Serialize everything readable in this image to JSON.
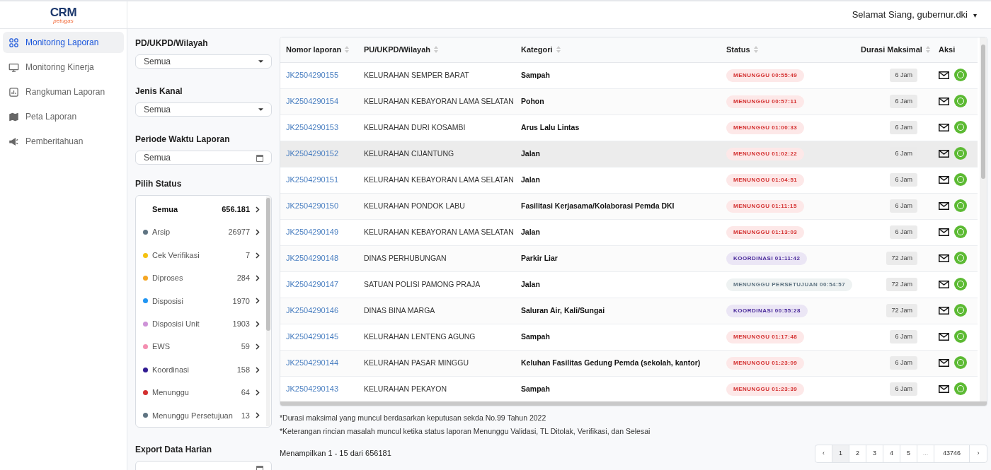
{
  "logo": {
    "brand": "CRM",
    "sub": "petugas"
  },
  "header": {
    "greeting": "Selamat Siang, gubernur.dki",
    "caret": "▾"
  },
  "sidebar": {
    "items": [
      {
        "label": "Monitoring Laporan",
        "selected": true
      },
      {
        "label": "Monitoring Kinerja",
        "selected": false
      },
      {
        "label": "Rangkuman Laporan",
        "selected": false
      },
      {
        "label": "Peta Laporan",
        "selected": false
      },
      {
        "label": "Pemberitahuan",
        "selected": false
      }
    ]
  },
  "filters": [
    {
      "label": "PD/UKPD/Wilayah",
      "value": "Semua",
      "kind": "dropdown"
    },
    {
      "label": "Jenis Kanal",
      "value": "Semua",
      "kind": "dropdown"
    },
    {
      "label": "Periode Waktu Laporan",
      "value": "Semua",
      "kind": "date"
    }
  ],
  "status_filter": {
    "label": "Pilih Status",
    "items": [
      {
        "label": "Semua",
        "count": "656.181",
        "selected": true
      },
      {
        "label": "Arsip",
        "count": "26977",
        "color": "#5f7482",
        "selected": false
      },
      {
        "label": "Cek Verifikasi",
        "count": "7",
        "color": "#f5c211",
        "selected": false
      },
      {
        "label": "Diproses",
        "count": "284",
        "color": "#f5a623",
        "selected": false
      },
      {
        "label": "Disposisi",
        "count": "1970",
        "color": "#2196f3",
        "selected": false
      },
      {
        "label": "Disposisi Unit",
        "count": "1903",
        "color": "#ce93d8",
        "selected": false
      },
      {
        "label": "EWS",
        "count": "59",
        "color": "#f48fb1",
        "selected": false
      },
      {
        "label": "Koordinasi",
        "count": "158",
        "color": "#311b92",
        "selected": false
      },
      {
        "label": "Menunggu",
        "count": "64",
        "color": "#d32f2f",
        "selected": false
      },
      {
        "label": "Menunggu Persetujuan",
        "count": "13",
        "color": "#5f7482",
        "selected": false
      }
    ]
  },
  "export": {
    "label": "Export Data Harian"
  },
  "table": {
    "columns": [
      {
        "label": "Nomor laporan",
        "sortable": true
      },
      {
        "label": "PU/UKPD/Wilayah",
        "sortable": true
      },
      {
        "label": "Kategori",
        "sortable": true
      },
      {
        "label": "Status",
        "sortable": true
      },
      {
        "label": "Durasi Maksimal",
        "sortable": true
      },
      {
        "label": "Aksi",
        "sortable": false
      }
    ],
    "rows": [
      {
        "id": "JK2504290155",
        "unit": "KELURAHAN SEMPER BARAT",
        "category": "Sampah",
        "status": "MENUNGGU 00:55:49",
        "kind": "menunggu",
        "duration": "6 Jam",
        "selected": false
      },
      {
        "id": "JK2504290154",
        "unit": "KELURAHAN KEBAYORAN LAMA SELATAN",
        "category": "Pohon",
        "status": "MENUNGGU 00:57:11",
        "kind": "menunggu",
        "duration": "6 Jam",
        "selected": false
      },
      {
        "id": "JK2504290153",
        "unit": "KELURAHAN DURI KOSAMBI",
        "category": "Arus Lalu Lintas",
        "status": "MENUNGGU 01:00:33",
        "kind": "menunggu",
        "duration": "6 Jam",
        "selected": false
      },
      {
        "id": "JK2504290152",
        "unit": "KELURAHAN CIJANTUNG",
        "category": "Jalan",
        "status": "MENUNGGU 01:02:22",
        "kind": "menunggu",
        "duration": "6 Jam",
        "selected": true
      },
      {
        "id": "JK2504290151",
        "unit": "KELURAHAN KEBAYORAN LAMA SELATAN",
        "category": "Jalan",
        "status": "MENUNGGU 01:04:51",
        "kind": "menunggu",
        "duration": "6 Jam",
        "selected": false
      },
      {
        "id": "JK2504290150",
        "unit": "KELURAHAN PONDOK LABU",
        "category": "Fasilitasi Kerjasama/Kolaborasi Pemda DKI",
        "status": "MENUNGGU 01:11:15",
        "kind": "menunggu",
        "duration": "6 Jam",
        "selected": false
      },
      {
        "id": "JK2504290149",
        "unit": "KELURAHAN KEBAYORAN LAMA SELATAN",
        "category": "Jalan",
        "status": "MENUNGGU 01:13:03",
        "kind": "menunggu",
        "duration": "6 Jam",
        "selected": false
      },
      {
        "id": "JK2504290148",
        "unit": "DINAS PERHUBUNGAN",
        "category": "Parkir Liar",
        "status": "KOORDINASI 01:11:42",
        "kind": "koordinasi",
        "duration": "72 Jam",
        "selected": false
      },
      {
        "id": "JK2504290147",
        "unit": "SATUAN POLISI PAMONG PRAJA",
        "category": "Jalan",
        "status": "MENUNGGU PERSETUJUAN 00:54:57",
        "kind": "persetujuan",
        "duration": "72 Jam",
        "selected": false
      },
      {
        "id": "JK2504290146",
        "unit": "DINAS BINA MARGA",
        "category": "Saluran Air, Kali/Sungai",
        "status": "KOORDINASI 00:55:28",
        "kind": "koordinasi",
        "duration": "72 Jam",
        "selected": false
      },
      {
        "id": "JK2504290145",
        "unit": "KELURAHAN LENTENG AGUNG",
        "category": "Sampah",
        "status": "MENUNGGU 01:17:48",
        "kind": "menunggu",
        "duration": "6 Jam",
        "selected": false
      },
      {
        "id": "JK2504290144",
        "unit": "KELURAHAN PASAR MINGGU",
        "category": "Keluhan Fasilitas Gedung Pemda (sekolah, kantor)",
        "status": "MENUNGGU 01:23:09",
        "kind": "menunggu",
        "duration": "6 Jam",
        "selected": false
      },
      {
        "id": "JK2504290143",
        "unit": "KELURAHAN PEKAYON",
        "category": "Sampah",
        "status": "MENUNGGU 01:23:39",
        "kind": "menunggu",
        "duration": "6 Jam",
        "selected": false
      }
    ]
  },
  "notes": [
    "*Durasi maksimal yang muncul berdasarkan keputusan sekda No.99 Tahun 2022",
    "*Keterangan rincian masalah muncul ketika status laporan Menunggu Validasi, TL Ditolak, Verifikasi, dan Selesai"
  ],
  "summary": "Menampilkan 1 - 15 dari 656181",
  "pagination": [
    {
      "label": "‹",
      "kind": "nav",
      "selected": false
    },
    {
      "label": "1",
      "kind": "page",
      "selected": true
    },
    {
      "label": "2",
      "kind": "page",
      "selected": false
    },
    {
      "label": "3",
      "kind": "page",
      "selected": false
    },
    {
      "label": "4",
      "kind": "page",
      "selected": false
    },
    {
      "label": "5",
      "kind": "page",
      "selected": false
    },
    {
      "label": "...",
      "kind": "gap",
      "selected": false
    },
    {
      "label": "43746",
      "kind": "page",
      "selected": false
    },
    {
      "label": "›",
      "kind": "nav",
      "selected": false
    }
  ]
}
